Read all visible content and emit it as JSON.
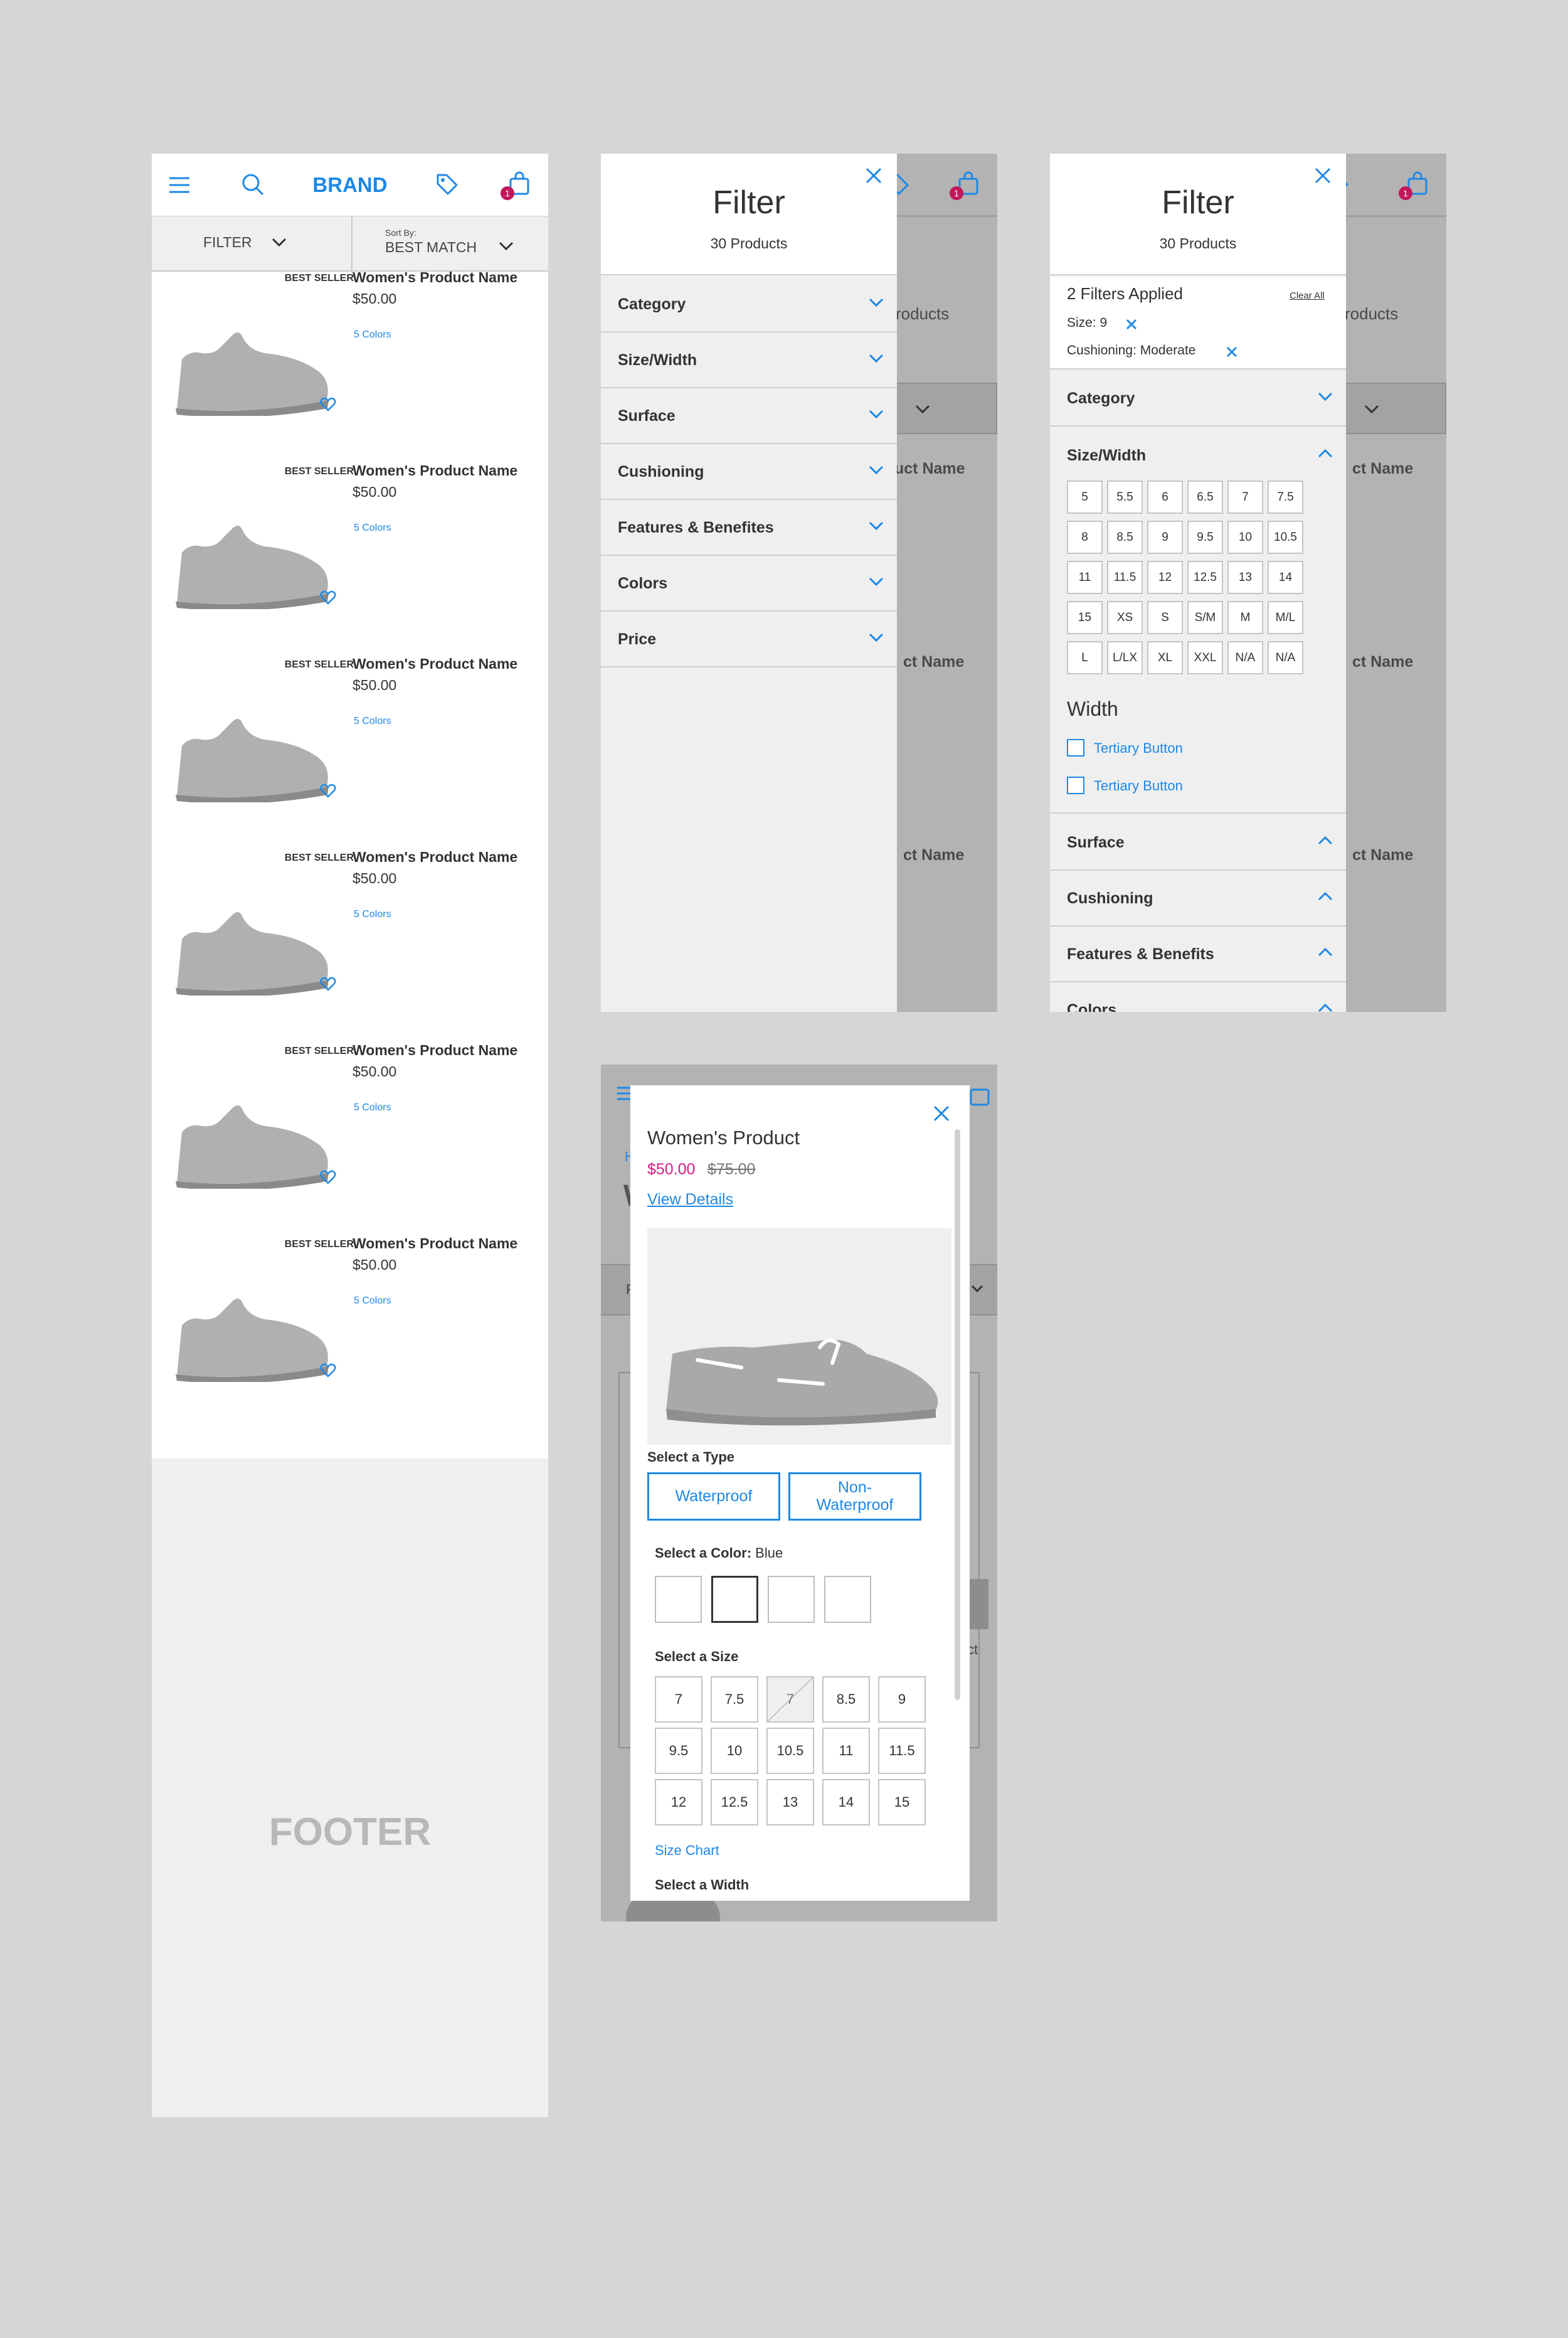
{
  "colors": {
    "accent": "#1e88e5",
    "sale": "#d81b84",
    "badge": "#c2185b"
  },
  "screen1": {
    "brand": "BRAND",
    "cart_count": "1",
    "filter_label": "FILTER",
    "sort_caption": "Sort By:",
    "sort_value": "BEST MATCH",
    "products": [
      {
        "badge": "BEST SELLER",
        "name": "Women's Product Name",
        "price": "$50.00",
        "colors": "5 Colors"
      },
      {
        "badge": "BEST SELLER",
        "name": "Women's Product Name",
        "price": "$50.00",
        "colors": "5 Colors"
      },
      {
        "badge": "BEST SELLER",
        "name": "Women's Product Name",
        "price": "$50.00",
        "colors": "5 Colors"
      },
      {
        "badge": "BEST SELLER",
        "name": "Women's Product Name",
        "price": "$50.00",
        "colors": "5 Colors"
      },
      {
        "badge": "BEST SELLER",
        "name": "Women's Product Name",
        "price": "$50.00",
        "colors": "5 Colors"
      },
      {
        "badge": "BEST SELLER",
        "name": "Women's Product Name",
        "price": "$50.00",
        "colors": "5 Colors"
      }
    ],
    "footer": "FOOTER"
  },
  "underlay": {
    "products_text": "roducts",
    "name_fragment": "ct Name",
    "name_fragment2": "uct Name",
    "frag_ct": "ct",
    "cart_count": "1"
  },
  "filter_panel": {
    "title": "Filter",
    "count": "30 Products",
    "sections": [
      "Category",
      "Size/Width",
      "Surface",
      "Cushioning",
      "Features & Benefites",
      "Colors",
      "Price"
    ]
  },
  "filter_panel2": {
    "title": "Filter",
    "count": "30 Products",
    "applied_count": "2 Filters Applied",
    "clear_all": "Clear All",
    "applied": [
      "Size: 9",
      "Cushioning: Moderate"
    ],
    "category": "Category",
    "size_width": "Size/Width",
    "sizes": [
      "5",
      "5.5",
      "6",
      "6.5",
      "7",
      "7.5",
      "8",
      "8.5",
      "9",
      "9.5",
      "10",
      "10.5",
      "11",
      "11.5",
      "12",
      "12.5",
      "13",
      "14",
      "15",
      "XS",
      "S",
      "S/M",
      "M",
      "M/L",
      "L",
      "L/LX",
      "XL",
      "XXL",
      "N/A",
      "N/A"
    ],
    "width_title": "Width",
    "width_options": [
      "Tertiary Button",
      "Tertiary Button"
    ],
    "collapsed": [
      "Surface",
      "Cushioning",
      "Features & Benefits",
      "Colors"
    ]
  },
  "quick_view": {
    "title": "Women's Product",
    "sale_price": "$50.00",
    "orig_price": "$75.00",
    "view_details": "View Details",
    "type_label": "Select a Type",
    "types": [
      "Waterproof",
      "Non-Waterproof"
    ],
    "color_label": "Select a Color:",
    "color_value": "Blue",
    "size_label": "Select a Size",
    "sizes": [
      "7",
      "7.5",
      "7",
      "8.5",
      "9",
      "9.5",
      "10",
      "10.5",
      "11",
      "11.5",
      "12",
      "12.5",
      "13",
      "14",
      "15"
    ],
    "size_chart": "Size Chart",
    "width_label": "Select a Width",
    "underlay_h": "H",
    "underlay_w": "W",
    "underlay_f": "F"
  }
}
